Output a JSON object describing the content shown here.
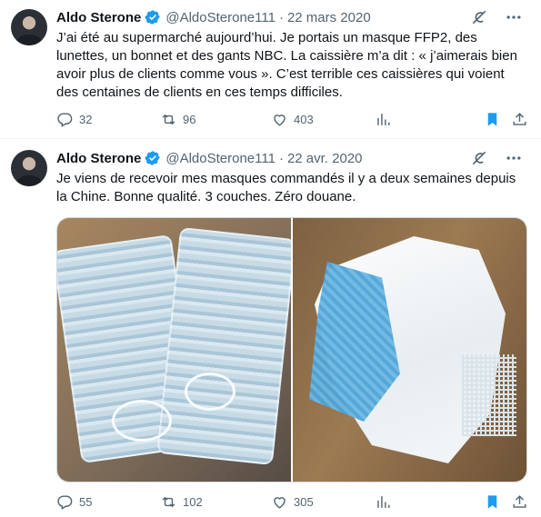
{
  "tweets": [
    {
      "author_name": "Aldo Sterone",
      "handle": "@AldoSterone111",
      "separator": "·",
      "date": "22 mars 2020",
      "text": "J’ai été au supermarché aujourd’hui. Je portais un masque FFP2, des lunettes, un bonnet et des gants NBC. La caissière m’a dit : « j’aimerais bien avoir plus de clients comme vous ».  C’est terrible ces caissières qui voient des centaines de clients en ces temps difficiles.",
      "stats": {
        "replies": "32",
        "retweets": "96",
        "likes": "403"
      },
      "bookmarked": true
    },
    {
      "author_name": "Aldo Sterone",
      "handle": "@AldoSterone111",
      "separator": "·",
      "date": "22 avr. 2020",
      "text": "Je viens de recevoir mes masques commandés il y a deux semaines depuis la Chine. Bonne qualité. 3 couches. Zéro douane.",
      "stats": {
        "replies": "55",
        "retweets": "102",
        "likes": "305"
      },
      "bookmarked": true,
      "media": [
        "packaged-surgical-masks-photo",
        "opened-mask-layers-photo"
      ]
    }
  ],
  "icons": {
    "verified": "verified-badge-icon",
    "grok": "grok-icon",
    "more": "more-icon",
    "reply": "reply-icon",
    "retweet": "retweet-icon",
    "like": "like-icon",
    "views": "views-icon",
    "bookmark": "bookmark-icon",
    "share": "share-icon"
  },
  "colors": {
    "accent": "#1d9bf0",
    "text": "#0f1419",
    "secondary": "#536471"
  }
}
